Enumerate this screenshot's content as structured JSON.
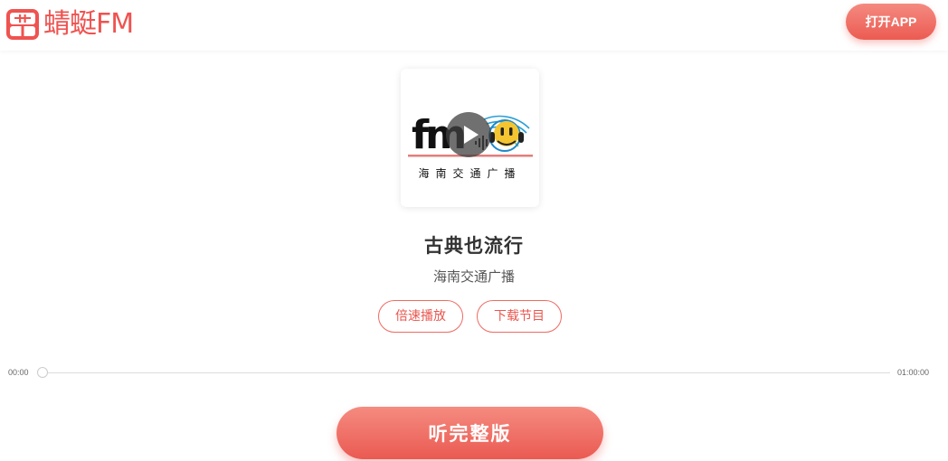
{
  "header": {
    "logo_text": "蜻蜓FM",
    "open_app_label": "打开APP"
  },
  "cover": {
    "caption": "海南交通广播",
    "logo_text": "fm"
  },
  "program": {
    "title": "古典也流行",
    "station": "海南交通广播"
  },
  "actions": {
    "speed_label": "倍速播放",
    "download_label": "下载节目"
  },
  "player": {
    "current_time": "00:00",
    "total_time": "01:00:00",
    "progress": 0
  },
  "cta": {
    "full_version_label": "听完整版"
  },
  "colors": {
    "brand": "#ef5350",
    "button_gradient_top": "#f58b80",
    "button_gradient_bottom": "#ea5a52"
  },
  "icons": {
    "logo": "dragonfly-radio-icon",
    "play": "play-icon"
  }
}
